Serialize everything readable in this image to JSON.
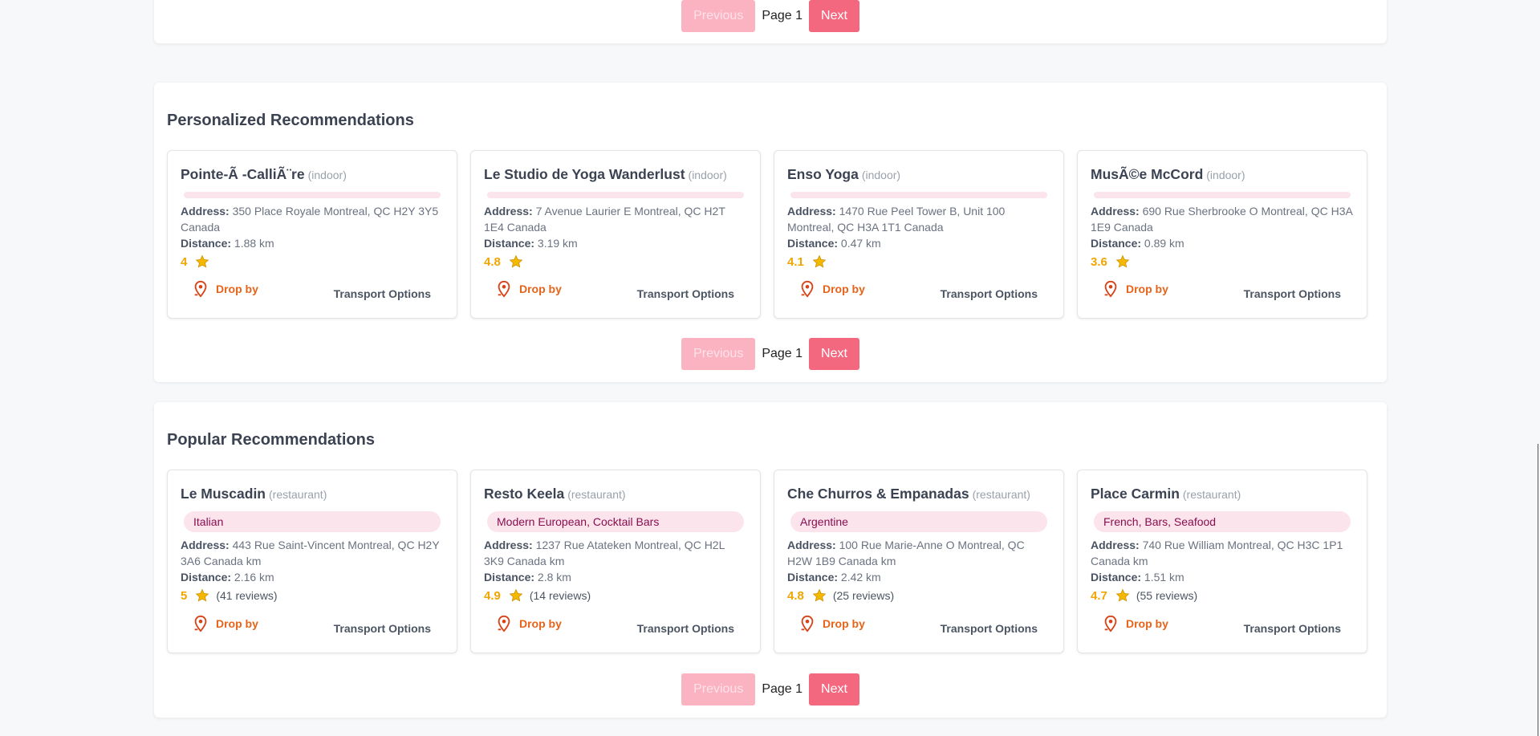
{
  "pagination": {
    "previous_label": "Previous",
    "page_label": "Page 1",
    "next_label": "Next"
  },
  "personalized": {
    "title": "Personalized Recommendations",
    "cards": [
      {
        "name": "Pointe-Ã -CalliÃ¨re",
        "type": "(indoor)",
        "address": "350 Place Royale Montreal, QC H2Y 3Y5 Canada",
        "distance": "1.88 km",
        "rating": "4"
      },
      {
        "name": "Le Studio de Yoga Wanderlust",
        "type": "(indoor)",
        "address": "7 Avenue Laurier E Montreal, QC H2T 1E4 Canada",
        "distance": "3.19 km",
        "rating": "4.8"
      },
      {
        "name": "Enso Yoga",
        "type": "(indoor)",
        "address": "1470 Rue Peel Tower B, Unit 100 Montreal, QC H3A 1T1 Canada",
        "distance": "0.47 km",
        "rating": "4.1"
      },
      {
        "name": "MusÃ©e McCord",
        "type": "(indoor)",
        "address": "690 Rue Sherbrooke O Montreal, QC H3A 1E9 Canada",
        "distance": "0.89 km",
        "rating": "3.6"
      }
    ]
  },
  "popular": {
    "title": "Popular Recommendations",
    "cards": [
      {
        "name": "Le Muscadin",
        "type": "(restaurant)",
        "tags": "Italian",
        "address": "443 Rue Saint-Vincent Montreal, QC H2Y 3A6 Canada km",
        "distance": "2.16 km",
        "rating": "5",
        "reviews": "(41 reviews)"
      },
      {
        "name": "Resto Keela",
        "type": "(restaurant)",
        "tags": "Modern European, Cocktail Bars",
        "address": "1237 Rue Atateken Montreal, QC H2L 3K9 Canada km",
        "distance": "2.8 km",
        "rating": "4.9",
        "reviews": "(14 reviews)"
      },
      {
        "name": "Che Churros & Empanadas",
        "type": "(restaurant)",
        "tags": "Argentine",
        "address": "100 Rue Marie-Anne O Montreal, QC H2W 1B9 Canada km",
        "distance": "2.42 km",
        "rating": "4.8",
        "reviews": "(25 reviews)"
      },
      {
        "name": "Place Carmin",
        "type": "(restaurant)",
        "tags": "French, Bars, Seafood",
        "address": "740 Rue William Montreal, QC H3C 1P1 Canada km",
        "distance": "1.51 km",
        "rating": "4.7",
        "reviews": "(55 reviews)"
      }
    ]
  },
  "labels": {
    "address": "Address:",
    "distance": "Distance:",
    "drop_by": "Drop by",
    "transport": "Transport Options"
  },
  "icons": {
    "star": "star-icon",
    "drop_by": "map-pin-icon"
  },
  "colors": {
    "rating": "#f0a500",
    "star": "#f5b800",
    "drop_by": "#e8631a",
    "next_button": "#f4687f",
    "prev_button": "#fbb3c1",
    "tag_background": "#fce4ec",
    "tag_text": "#880e4f"
  }
}
